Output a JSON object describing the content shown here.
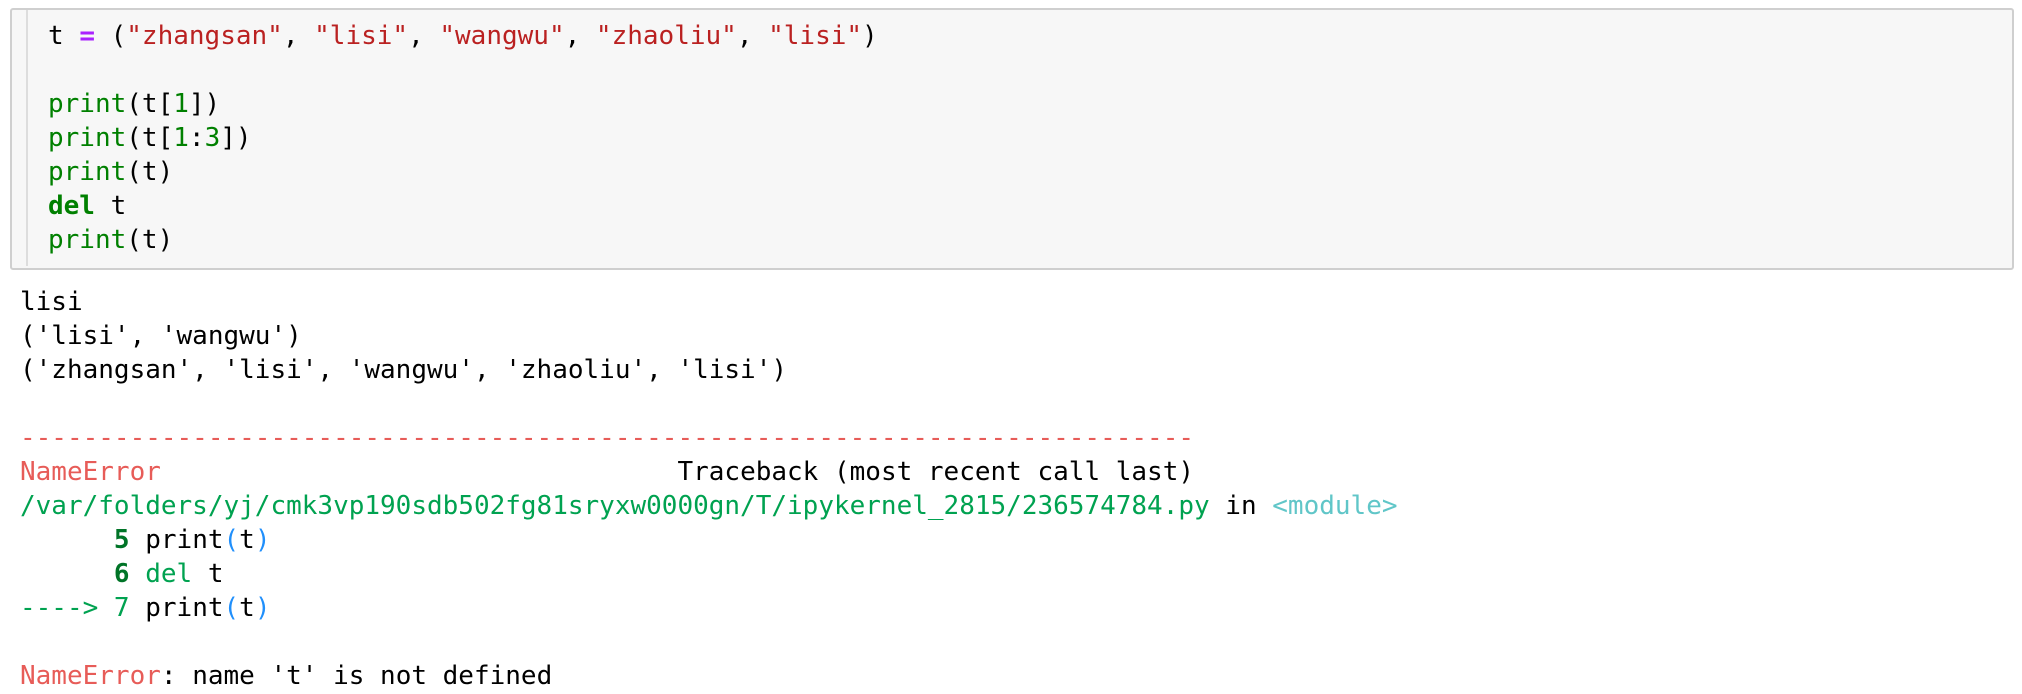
{
  "code_cell": {
    "line1": {
      "var": "t",
      "op": "=",
      "open": "(",
      "s1": "\"zhangsan\"",
      "s2": "\"lisi\"",
      "s3": "\"wangwu\"",
      "s4": "\"zhaoliu\"",
      "s5": "\"lisi\"",
      "close": ")"
    },
    "line3": {
      "fn": "print",
      "pre": "(t[",
      "n1": "1",
      "post": "])"
    },
    "line4": {
      "fn": "print",
      "pre": "(t[",
      "n1": "1",
      "colon": ":",
      "n2": "3",
      "post": "])"
    },
    "line5": {
      "fn": "print",
      "args": "(t)"
    },
    "line6": {
      "kw": "del",
      "arg": " t"
    },
    "line7": {
      "fn": "print",
      "args": "(t)"
    }
  },
  "output": {
    "stdout": [
      "lisi",
      "('lisi', 'wangwu')",
      "('zhangsan', 'lisi', 'wangwu', 'zhaoliu', 'lisi')"
    ],
    "traceback": {
      "dashes": "---------------------------------------------------------------------------",
      "error_name": "NameError",
      "header_gap": "                                 ",
      "header": "Traceback (most recent call last)",
      "file_path": "/var/folders/yj/cmk3vp190sdb502fg81sryxw0000gn/T/ipykernel_2815/236574784.py",
      "in_word": " in ",
      "module": "<module>",
      "frames": [
        {
          "indent": "      ",
          "lineno": "5",
          "fn": " print",
          "open": "(",
          "arg": "t",
          "close": ")"
        },
        {
          "indent": "      ",
          "lineno": "6",
          "kw": " del",
          "arg": " t"
        },
        {
          "arrow": "----> ",
          "lineno": "7",
          "fn": " print",
          "open": "(",
          "arg": "t",
          "close": ")"
        }
      ],
      "final_error": "NameError",
      "final_message": ": name 't' is not defined"
    }
  },
  "colors": {
    "string": "#ba2121",
    "keyword": "#008000",
    "operator": "#aa22ff",
    "error_red": "#e75c58",
    "error_green": "#00a250",
    "error_cyan": "#60c6c8",
    "error_blue": "#208ffb"
  }
}
